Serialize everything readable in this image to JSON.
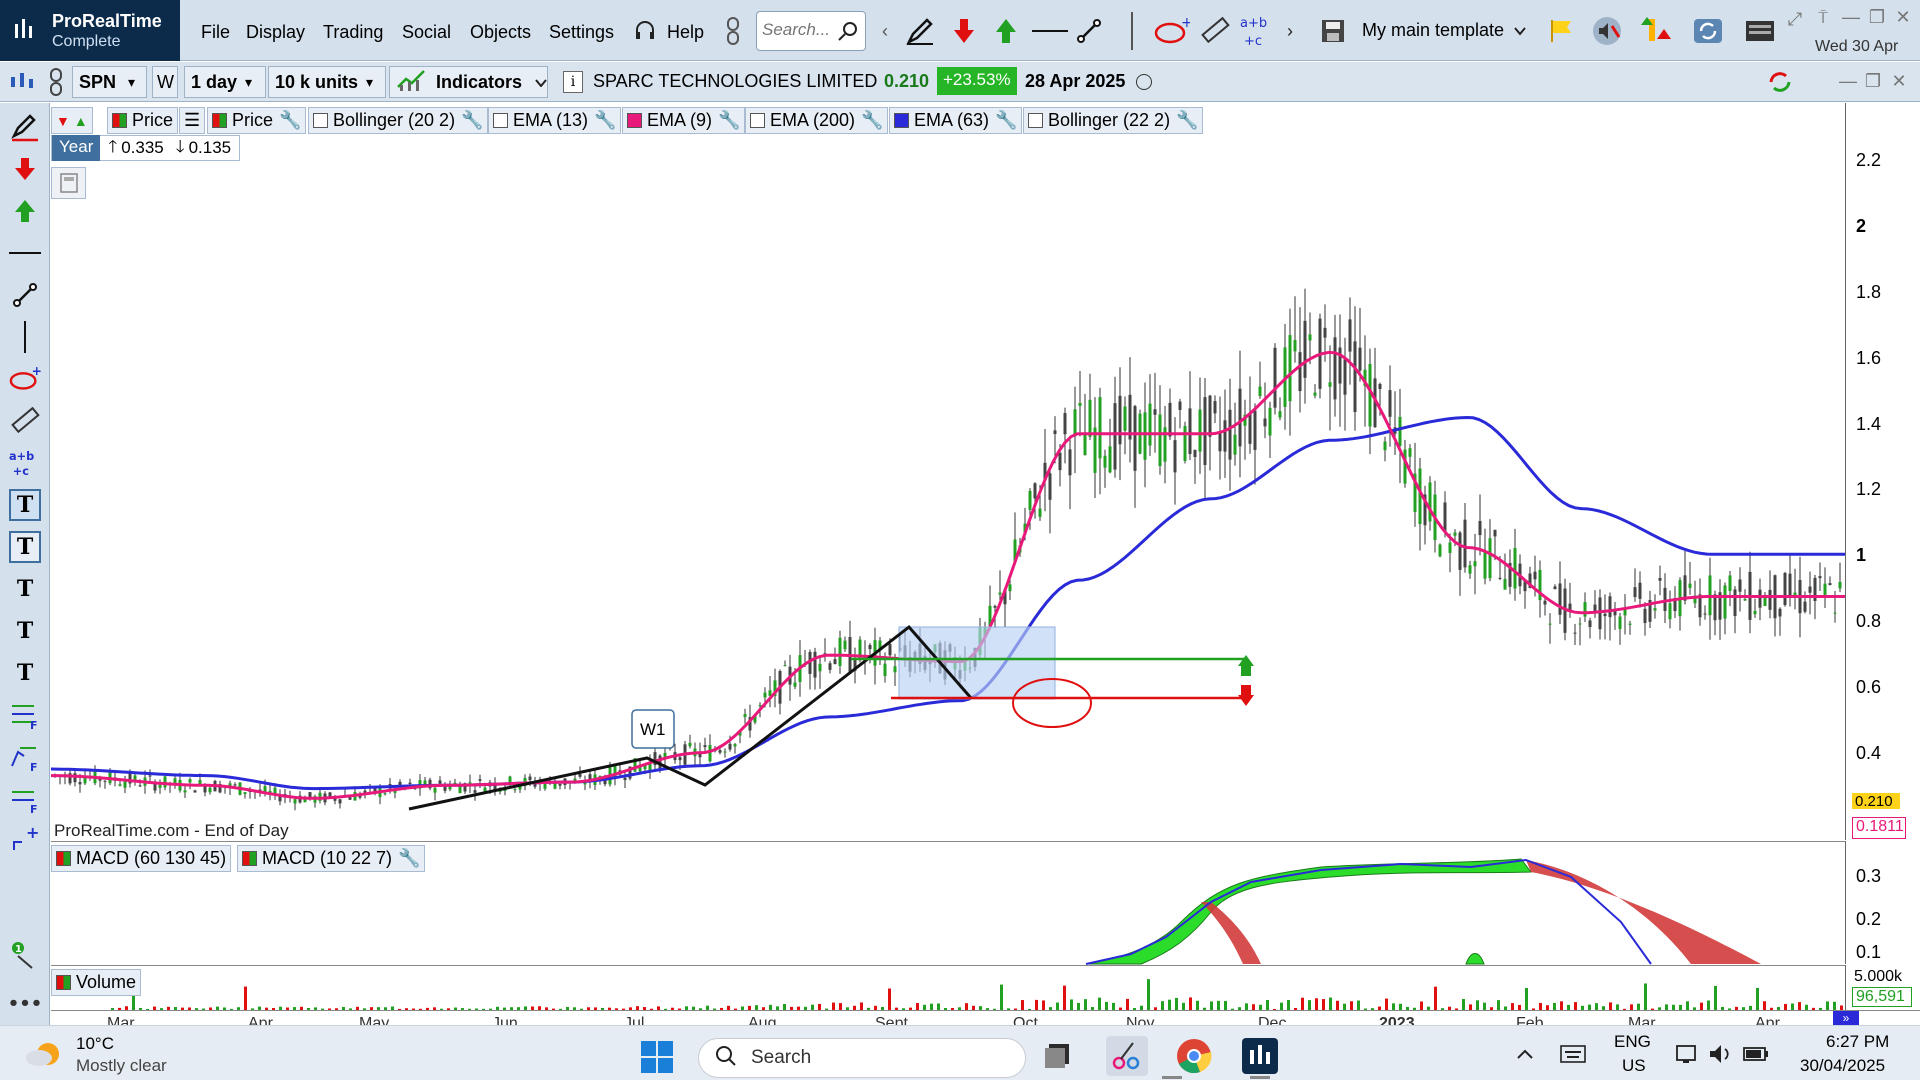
{
  "app": {
    "name": "ProRealTime",
    "edition": "Complete"
  },
  "menu": {
    "items": [
      "File",
      "Display",
      "Trading",
      "Social",
      "Objects",
      "Settings"
    ],
    "help": "Help",
    "search_placeholder": "Search...",
    "template": "My main template",
    "date": "Wed 30 Apr"
  },
  "toolbar": {
    "ticker": "SPN",
    "ticker_flag": "W",
    "period": "1 day",
    "units": "10 k units",
    "indicators": "Indicators",
    "instrument_name": "SPARC TECHNOLOGIES LIMITED",
    "price": "0.210",
    "change": "+23.53%",
    "date": "28 Apr 2025"
  },
  "legend": {
    "price1": "Price",
    "price2": "Price",
    "ind1": "Bollinger (20 2)",
    "ind2": "EMA (13)",
    "ind3": "EMA (9)",
    "ind4": "EMA (200)",
    "ind5": "EMA (63)",
    "ind6": "Bollinger (22 2)",
    "year": "Year",
    "year_high": "0.335",
    "year_low": "0.135",
    "source": "ProRealTime.com - End of Day",
    "pattern_label": "W1"
  },
  "colors": {
    "ema9": "#e8197a",
    "ema63": "#2a2ad8",
    "accent_green": "#26b526",
    "panel_bg": "#d4e0ec"
  },
  "price_axis": {
    "labels": [
      "2.2",
      "2",
      "1.8",
      "1.6",
      "1.4",
      "1.2",
      "1",
      "0.8",
      "0.6",
      "0.4"
    ],
    "current_price": "0.210",
    "marker_value": "0.1811"
  },
  "macd": {
    "label1": "MACD (60 130 45)",
    "label2": "MACD (10 22 7)",
    "axis": [
      "0.3",
      "0.2",
      "0.1"
    ]
  },
  "volume": {
    "label": "Volume",
    "axis_top": "5.000k",
    "axis_value": "96,591"
  },
  "date_axis": [
    "Mar",
    "Apr",
    "May",
    "Jun",
    "Jul",
    "Aug",
    "Sept",
    "Oct",
    "Nov",
    "Dec",
    "2023",
    "Feb",
    "Mar",
    "Apr"
  ],
  "chart_data": {
    "type": "line",
    "x": [
      "Mar 2024",
      "Apr 2024",
      "May 2024",
      "Jun 2024",
      "Jul 2024",
      "Aug 2024",
      "Sept 2024",
      "Oct 2024",
      "Nov 2024",
      "Dec 2024",
      "Jan 2025",
      "Feb 2025",
      "Mar 2025",
      "Apr 2025"
    ],
    "series": [
      {
        "name": "EMA (9)",
        "values": [
          0.3,
          0.27,
          0.23,
          0.27,
          0.28,
          0.37,
          0.67,
          0.65,
          1.35,
          1.35,
          1.6,
          1.0,
          0.8,
          0.85
        ]
      },
      {
        "name": "EMA (63)",
        "values": [
          0.32,
          0.3,
          0.26,
          0.27,
          0.28,
          0.33,
          0.48,
          0.53,
          0.9,
          1.15,
          1.33,
          1.4,
          1.12,
          0.98
        ]
      }
    ],
    "ylim": [
      0.15,
      2.3
    ]
  },
  "taskbar": {
    "weather_temp": "10°C",
    "weather_desc": "Mostly clear",
    "search": "Search",
    "lang": "ENG",
    "region": "US",
    "time": "6:27 PM",
    "date": "30/04/2025"
  }
}
